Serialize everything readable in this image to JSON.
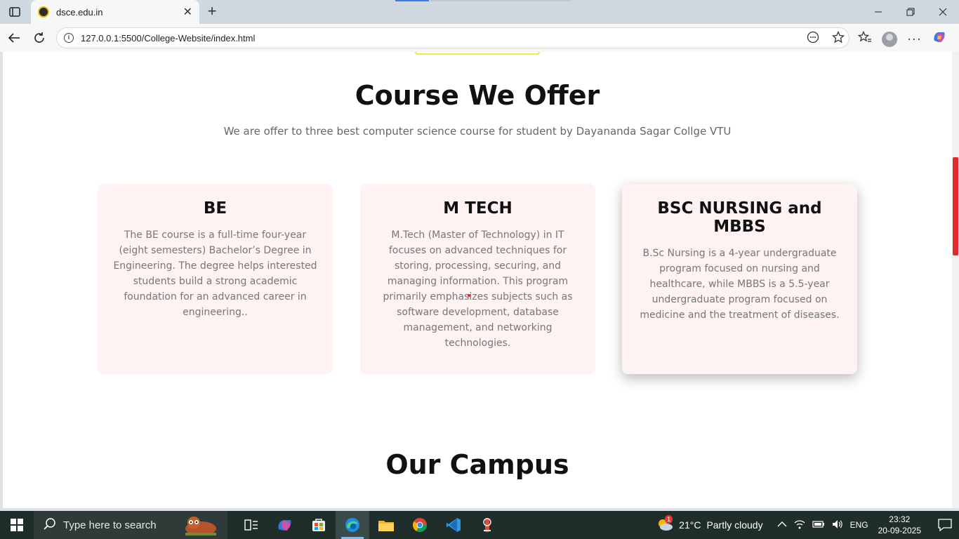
{
  "browser": {
    "tab_title": "dsce.edu.in",
    "url": "127.0.0.1:5500/College-Website/index.html"
  },
  "page": {
    "courses_title": "Course We Offer",
    "courses_subtitle": "We are offer to three best computer science course for student by Dayananda Sagar Collge VTU",
    "cards": [
      {
        "title": "BE",
        "text": "The BE course is a full-time four-year (eight semesters) Bachelor’s Degree in Engineering. The degree helps interested students build a strong academic foundation for an advanced career in engineering.."
      },
      {
        "title": "M TECH",
        "text": "M.Tech (Master of Technology) in IT focuses on advanced techniques for storing, processing, securing, and managing information. This program primarily emphasizes subjects such as software development, database management, and networking technologies."
      },
      {
        "title": "BSC NURSING and MBBS",
        "text": "B.Sc Nursing is a 4-year undergraduate program focused on nursing and healthcare, while MBBS is a 5.5-year undergraduate program focused on medicine and the treatment of diseases."
      }
    ],
    "campus_title": "Our Campus"
  },
  "taskbar": {
    "search_placeholder": "Type here to search",
    "weather_temp": "21°C",
    "weather_desc": "Partly cloudy",
    "weather_badge": "1",
    "language": "ENG",
    "time": "23:32",
    "date": "20-09-2025"
  },
  "colors": {
    "card_bg": "#fff2f2",
    "scroll_accent": "#e22a2a",
    "taskbar_bg": "#1f2d2b"
  }
}
